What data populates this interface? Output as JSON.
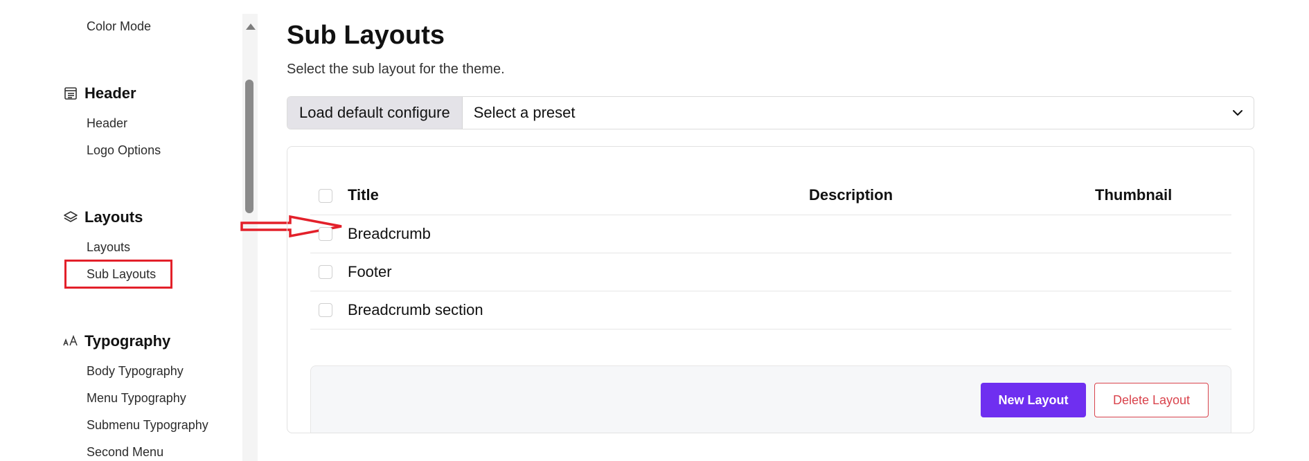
{
  "sidebar": {
    "color_mode": "Color Mode",
    "groups": [
      {
        "title": "Header",
        "icon": "header-layout-icon",
        "items": [
          "Header",
          "Logo Options"
        ]
      },
      {
        "title": "Layouts",
        "icon": "layers-icon",
        "items": [
          "Layouts",
          "Sub Layouts"
        ]
      },
      {
        "title": "Typography",
        "icon": "typography-icon",
        "items": [
          "Body Typography",
          "Menu Typography",
          "Submenu Typography",
          "Second Menu"
        ]
      }
    ]
  },
  "main": {
    "title": "Sub Layouts",
    "subtitle": "Select the sub layout for the theme.",
    "preset": {
      "label": "Load default configure",
      "placeholder": "Select a preset"
    },
    "table": {
      "columns": [
        "Title",
        "Description",
        "Thumbnail"
      ],
      "rows": [
        {
          "title": "Breadcrumb"
        },
        {
          "title": "Footer"
        },
        {
          "title": "Breadcrumb section"
        }
      ]
    },
    "buttons": {
      "new": "New Layout",
      "delete": "Delete Layout"
    }
  },
  "colors": {
    "accent": "#6f2ff0",
    "danger": "#d9434c",
    "annotation": "#e3202a"
  }
}
